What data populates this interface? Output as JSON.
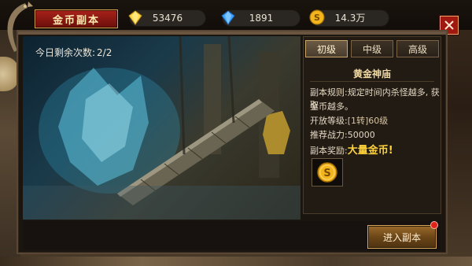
{
  "header": {
    "title": "金币副本"
  },
  "resources": [
    {
      "icon": "yellow-diamond-icon",
      "value": "53476"
    },
    {
      "icon": "blue-diamond-icon",
      "value": "1891"
    },
    {
      "icon": "gold-coin-icon",
      "value": "14.3万"
    }
  ],
  "remaining": {
    "label": "今日剩余次数:",
    "value": "2/2"
  },
  "tabs": [
    {
      "label": "初级",
      "active": true
    },
    {
      "label": "中级",
      "active": false
    },
    {
      "label": "高级",
      "active": false
    }
  ],
  "dungeon": {
    "name": "黄金神庙",
    "rule_label": "副本规则:",
    "rule_text_1": "规定时间内杀怪越多, 获取",
    "rule_text_2": "金币越多。",
    "level_label": "开放等级:",
    "level_value": "[1转]60级",
    "power_label": "推荐战力:",
    "power_value": "50000",
    "reward_label": "副本奖励:",
    "reward_value": "大量金币!",
    "reward_icon": "gold-coin-icon"
  },
  "enter_button": {
    "label": "进入副本"
  },
  "colors": {
    "accent_red": "#a0180f",
    "gold_text": "#ffd23a",
    "panel_border": "#5a4634"
  }
}
